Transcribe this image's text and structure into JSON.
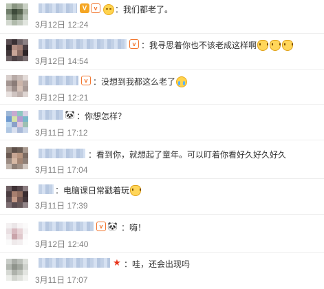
{
  "comments": [
    {
      "text": "：我们都老了。",
      "emojis_after": [
        "smile-emoji"
      ],
      "time": "3月12日 12:24"
    },
    {
      "text": "：我寻思着你也不该老成这样啊",
      "emojis_after": [
        "cat-emoji",
        "cat-emoji",
        "cat-emoji"
      ],
      "time": "3月12日 14:54"
    },
    {
      "text": "：没想到我都这么老了",
      "emojis_after": [
        "cry-emoji"
      ],
      "time": "3月12日 12:21"
    },
    {
      "text": "：你想怎样？",
      "emojis_after": [],
      "time": "3月11日 17:12"
    },
    {
      "text": "：看到你，就想起了童年。可以盯着你看好久好久好久",
      "emojis_after": [],
      "time": "3月11日 17:04"
    },
    {
      "text": "：电脑课日常戳着玩",
      "emojis_after": [
        "cat-emoji"
      ],
      "time": "3月11日 17:39"
    },
    {
      "text": "：嗨！",
      "emojis_after": [],
      "time": "3月12日 12:40"
    },
    {
      "text": "：哇，还会出现吗",
      "emojis_after": [],
      "time": "3月11日 17:07"
    }
  ],
  "badge_glyphs": {
    "verified": "V",
    "vip": "v",
    "panda": "🐼",
    "star": "★"
  },
  "colors": {
    "text": "#333333",
    "time": "#808080",
    "divider": "#eeeeee",
    "vip_orange": "#f2762e",
    "verified_gold": "#f5a623",
    "star_red": "#e8341a"
  }
}
